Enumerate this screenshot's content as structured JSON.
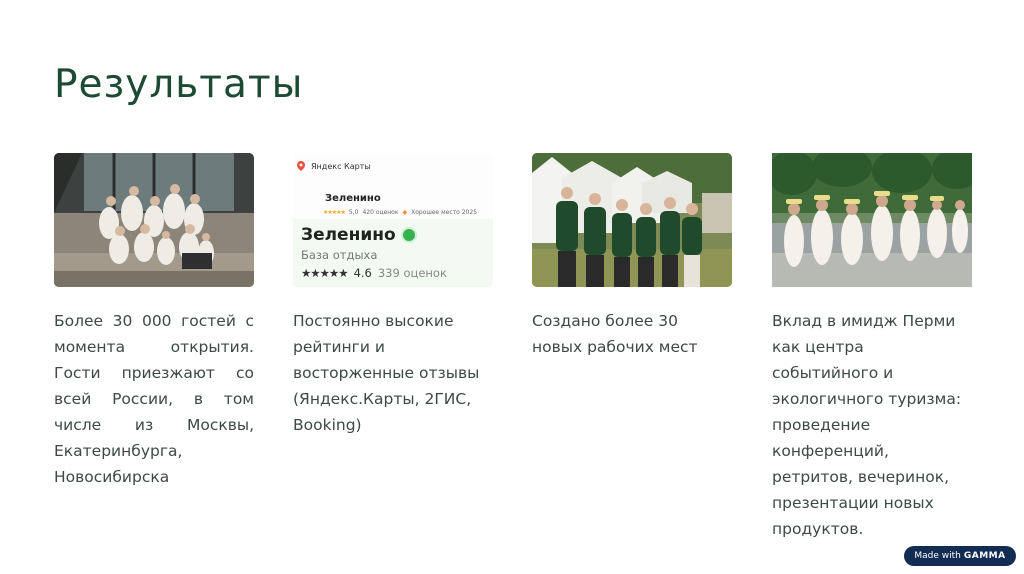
{
  "title": "Результаты",
  "columns": [
    {
      "text": "Более 30 000 гостей с момента открытия. Гости приезжают со всей России, в том числе из Москвы, Екатеринбурга, Новосибирска"
    },
    {
      "text": "Постоянно высокие рейтинги и восторженные отзывы (Яндекс.Карты, 2ГИС, Booking)"
    },
    {
      "text": "Создано более 30 новых рабочих мест"
    },
    {
      "text": "Вклад в имидж Перми как центра событийного и экологичного туризма: проведение конференций, ретритов, вечеринок, презентации новых продуктов."
    }
  ],
  "ratings_card": {
    "app_name": "Яндекс Карты",
    "place_name_small": "Зеленино",
    "small_stars": "★★★★★",
    "small_rating": "5,0",
    "small_count": "420 оценок",
    "small_badge": "Хорошее место 2025",
    "place_name": "Зеленино",
    "category": "База отдыха",
    "stars": "★★★★★",
    "rating": "4.6",
    "count": "339 оценок"
  },
  "badge": {
    "made_with": "Made with",
    "brand": "GAMMA"
  }
}
